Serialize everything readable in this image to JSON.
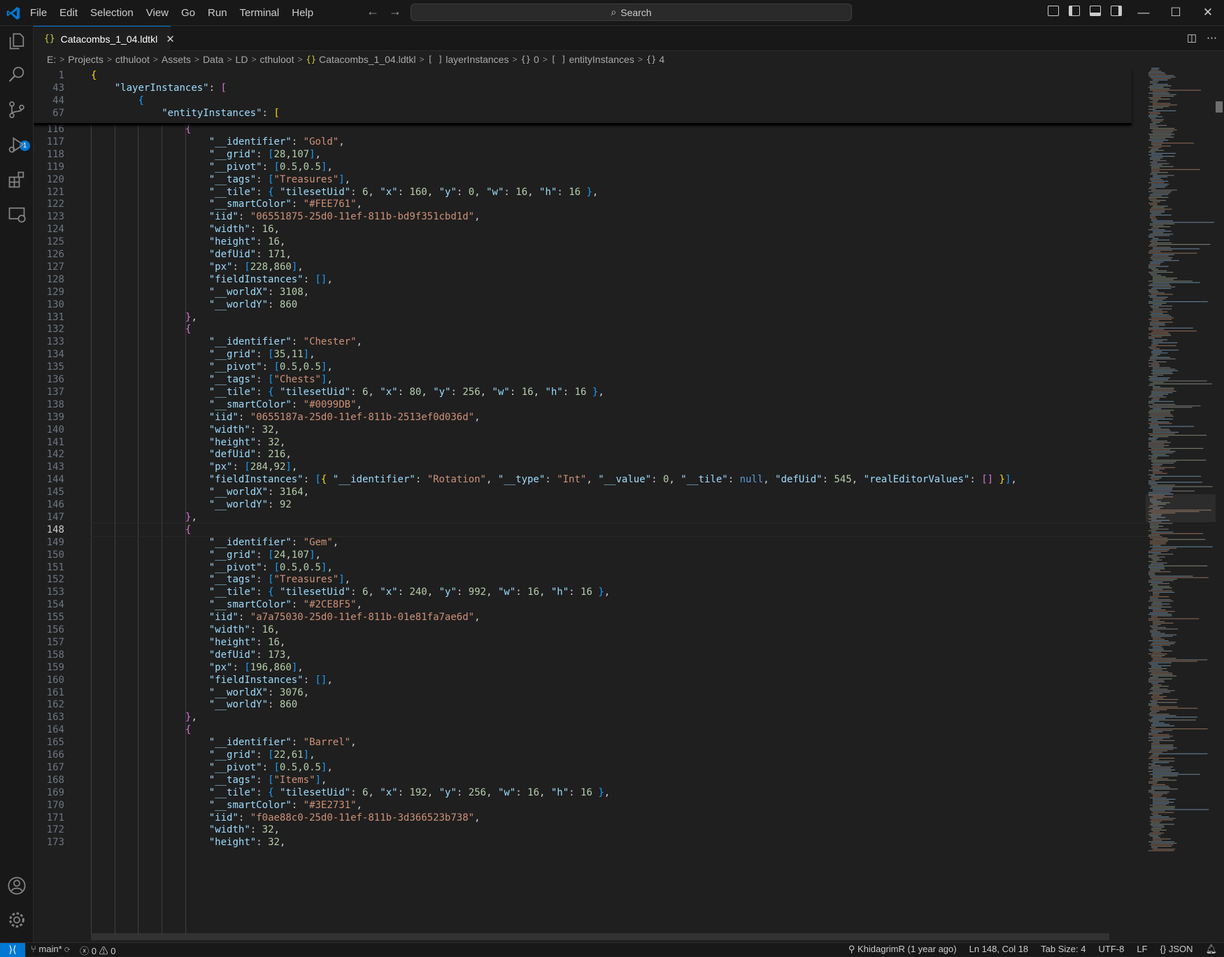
{
  "menu": [
    "File",
    "Edit",
    "Selection",
    "View",
    "Go",
    "Run",
    "Terminal",
    "Help"
  ],
  "search": {
    "label": "Search"
  },
  "tab": {
    "icon": "{}",
    "filename": "Catacombs_1_04.ldtkl",
    "close": "✕"
  },
  "breadcrumb": {
    "drive": "E:",
    "folders": [
      "Projects",
      "cthuloot",
      "Assets",
      "Data",
      "LD",
      "cthuloot"
    ],
    "file_icon": "{}",
    "file": "Catacombs_1_04.ldtkl",
    "path": [
      {
        "icon": "[ ]",
        "label": "layerInstances"
      },
      {
        "icon": "{}",
        "label": "0"
      },
      {
        "icon": "[ ]",
        "label": "entityInstances"
      },
      {
        "icon": "{}",
        "label": "4"
      }
    ]
  },
  "badges": {
    "source_control": "1"
  },
  "status": {
    "branch": "main*",
    "errors": "0",
    "warnings": "0",
    "blame": "KhidagrimR (1 year ago)",
    "position": "Ln 148, Col 18",
    "tab_size": "Tab Size: 4",
    "encoding": "UTF-8",
    "eol": "LF",
    "language": "JSON"
  },
  "editor": {
    "current_line": "148",
    "sticky": [
      {
        "n": "1",
        "t": "{"
      },
      {
        "n": "43",
        "t": "    \"layerInstances\": ["
      },
      {
        "n": "44",
        "t": "        {"
      },
      {
        "n": "67",
        "t": "            \"entityInstances\": ["
      }
    ],
    "lines": [
      {
        "n": "116",
        "t": "                {"
      },
      {
        "n": "117",
        "t": "                    \"__identifier\": \"Gold\","
      },
      {
        "n": "118",
        "t": "                    \"__grid\": [28,107],"
      },
      {
        "n": "119",
        "t": "                    \"__pivot\": [0.5,0.5],"
      },
      {
        "n": "120",
        "t": "                    \"__tags\": [\"Treasures\"],"
      },
      {
        "n": "121",
        "t": "                    \"__tile\": { \"tilesetUid\": 6, \"x\": 160, \"y\": 0, \"w\": 16, \"h\": 16 },"
      },
      {
        "n": "122",
        "t": "                    \"__smartColor\": \"#FEE761\","
      },
      {
        "n": "123",
        "t": "                    \"iid\": \"06551875-25d0-11ef-811b-bd9f351cbd1d\","
      },
      {
        "n": "124",
        "t": "                    \"width\": 16,"
      },
      {
        "n": "125",
        "t": "                    \"height\": 16,"
      },
      {
        "n": "126",
        "t": "                    \"defUid\": 171,"
      },
      {
        "n": "127",
        "t": "                    \"px\": [228,860],"
      },
      {
        "n": "128",
        "t": "                    \"fieldInstances\": [],"
      },
      {
        "n": "129",
        "t": "                    \"__worldX\": 3108,"
      },
      {
        "n": "130",
        "t": "                    \"__worldY\": 860"
      },
      {
        "n": "131",
        "t": "                },"
      },
      {
        "n": "132",
        "t": "                {"
      },
      {
        "n": "133",
        "t": "                    \"__identifier\": \"Chester\","
      },
      {
        "n": "134",
        "t": "                    \"__grid\": [35,11],"
      },
      {
        "n": "135",
        "t": "                    \"__pivot\": [0.5,0.5],"
      },
      {
        "n": "136",
        "t": "                    \"__tags\": [\"Chests\"],"
      },
      {
        "n": "137",
        "t": "                    \"__tile\": { \"tilesetUid\": 6, \"x\": 80, \"y\": 256, \"w\": 16, \"h\": 16 },"
      },
      {
        "n": "138",
        "t": "                    \"__smartColor\": \"#0099DB\","
      },
      {
        "n": "139",
        "t": "                    \"iid\": \"0655187a-25d0-11ef-811b-2513ef0d036d\","
      },
      {
        "n": "140",
        "t": "                    \"width\": 32,"
      },
      {
        "n": "141",
        "t": "                    \"height\": 32,"
      },
      {
        "n": "142",
        "t": "                    \"defUid\": 216,"
      },
      {
        "n": "143",
        "t": "                    \"px\": [284,92],"
      },
      {
        "n": "144",
        "t": "                    \"fieldInstances\": [{ \"__identifier\": \"Rotation\", \"__type\": \"Int\", \"__value\": 0, \"__tile\": null, \"defUid\": 545, \"realEditorValues\": [] }],"
      },
      {
        "n": "145",
        "t": "                    \"__worldX\": 3164,"
      },
      {
        "n": "146",
        "t": "                    \"__worldY\": 92"
      },
      {
        "n": "147",
        "t": "                },"
      },
      {
        "n": "148",
        "t": "                {"
      },
      {
        "n": "149",
        "t": "                    \"__identifier\": \"Gem\","
      },
      {
        "n": "150",
        "t": "                    \"__grid\": [24,107],"
      },
      {
        "n": "151",
        "t": "                    \"__pivot\": [0.5,0.5],"
      },
      {
        "n": "152",
        "t": "                    \"__tags\": [\"Treasures\"],"
      },
      {
        "n": "153",
        "t": "                    \"__tile\": { \"tilesetUid\": 6, \"x\": 240, \"y\": 992, \"w\": 16, \"h\": 16 },"
      },
      {
        "n": "154",
        "t": "                    \"__smartColor\": \"#2CE8F5\","
      },
      {
        "n": "155",
        "t": "                    \"iid\": \"a7a75030-25d0-11ef-811b-01e81fa7ae6d\","
      },
      {
        "n": "156",
        "t": "                    \"width\": 16,"
      },
      {
        "n": "157",
        "t": "                    \"height\": 16,"
      },
      {
        "n": "158",
        "t": "                    \"defUid\": 173,"
      },
      {
        "n": "159",
        "t": "                    \"px\": [196,860],"
      },
      {
        "n": "160",
        "t": "                    \"fieldInstances\": [],"
      },
      {
        "n": "161",
        "t": "                    \"__worldX\": 3076,"
      },
      {
        "n": "162",
        "t": "                    \"__worldY\": 860"
      },
      {
        "n": "163",
        "t": "                },"
      },
      {
        "n": "164",
        "t": "                {"
      },
      {
        "n": "165",
        "t": "                    \"__identifier\": \"Barrel\","
      },
      {
        "n": "166",
        "t": "                    \"__grid\": [22,61],"
      },
      {
        "n": "167",
        "t": "                    \"__pivot\": [0.5,0.5],"
      },
      {
        "n": "168",
        "t": "                    \"__tags\": [\"Items\"],"
      },
      {
        "n": "169",
        "t": "                    \"__tile\": { \"tilesetUid\": 6, \"x\": 192, \"y\": 256, \"w\": 16, \"h\": 16 },"
      },
      {
        "n": "170",
        "t": "                    \"__smartColor\": \"#3E2731\","
      },
      {
        "n": "171",
        "t": "                    \"iid\": \"f0ae88c0-25d0-11ef-811b-3d366523b738\","
      },
      {
        "n": "172",
        "t": "                    \"width\": 32,"
      },
      {
        "n": "173",
        "t": "                    \"height\": 32,"
      }
    ]
  }
}
